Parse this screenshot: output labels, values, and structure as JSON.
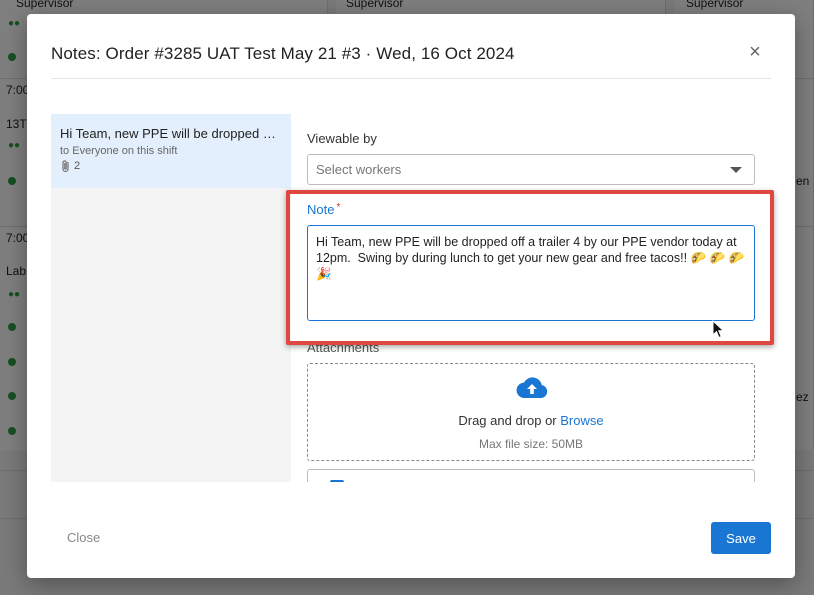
{
  "background": {
    "labels": [
      "Supervisor",
      "Supervisor",
      "Supervisor",
      "7:00",
      "13T",
      "7:00",
      "Lab",
      "en",
      "ez"
    ]
  },
  "modal": {
    "title": "Notes: Order #3285 UAT Test May 21 #3 · Wed, 16 Oct 2024",
    "close_icon": "×"
  },
  "notes": [
    {
      "title": "Hi Team, new PPE will be dropped off a trailer 4 by our PPE vendor today at 12pm.",
      "audience": "to Everyone on this shift",
      "attachment_count": "2"
    }
  ],
  "form": {
    "viewable_label": "Viewable by",
    "viewable_placeholder": "Select workers",
    "note_label": "Note",
    "required_mark": "*",
    "note_value": "Hi Team, new PPE will be dropped off a trailer 4 by our PPE vendor today at 12pm.  Swing by during lunch to get your new gear and free tacos!! 🌮 🌮 🌮 🎉",
    "attachments_label": "Attachments",
    "drop_text": "Drag and drop or",
    "browse_link": "Browse",
    "max_size": "Max file size: 50MB"
  },
  "footer": {
    "close_label": "Close",
    "save_label": "Save"
  },
  "colors": {
    "accent": "#1976d2",
    "highlight": "#e0473f",
    "selected_note": "#e3effc"
  }
}
